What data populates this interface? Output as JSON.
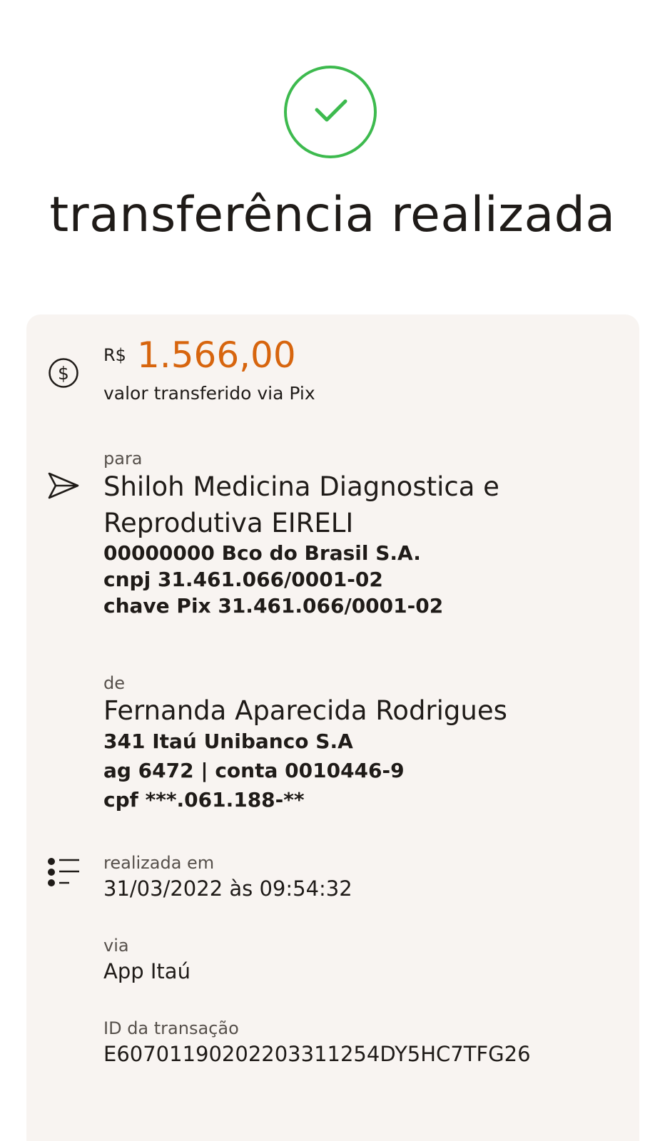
{
  "header": {
    "title": "transferência realizada",
    "status_icon": "check-circle-icon",
    "status_color": "#3dba4e"
  },
  "amount": {
    "currency": "R$",
    "value": "1.566,00",
    "caption": "valor transferido via Pix",
    "icon": "dollar-circle-icon",
    "accent_color": "#d7650e"
  },
  "recipient": {
    "label": "para",
    "name_line1": "Shiloh Medicina Diagnostica e",
    "name_line2": "Reprodutiva EIRELI",
    "bank": "00000000 Bco do Brasil S.A.",
    "cnpj": "cnpj 31.461.066/0001-02",
    "pix_key": "chave Pix 31.461.066/0001-02",
    "icon": "send-icon"
  },
  "sender": {
    "label": "de",
    "name": "Fernanda Aparecida Rodrigues",
    "bank": "341 Itaú Unibanco S.A",
    "account": "ag 6472 | conta 0010446-9",
    "cpf": "cpf ***.061.188-**"
  },
  "details": {
    "icon": "list-icon",
    "date_label": "realizada em",
    "date_value": "31/03/2022 às 09:54:32",
    "via_label": "via",
    "via_value": "App Itaú",
    "id_label": "ID da transação",
    "id_value": "E60701190202203311254DY5HC7TFG26"
  }
}
